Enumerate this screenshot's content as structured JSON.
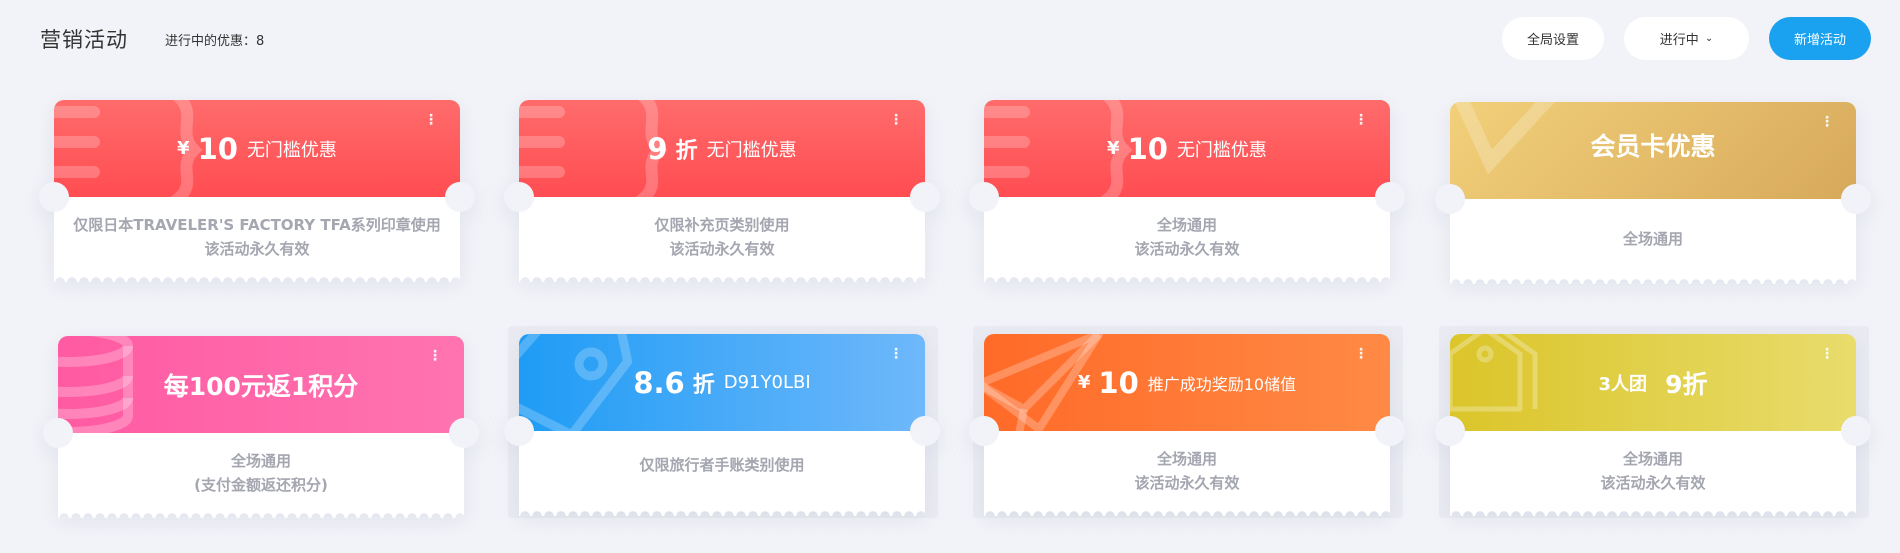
{
  "header": {
    "title": "营销活动",
    "active_label": "进行中的优惠：8",
    "global_settings": "全局设置",
    "status_filter": "进行中",
    "new_activity": "新增活动"
  },
  "colors": {
    "accent": "#1aa1f0",
    "red": "#ff4d52",
    "gold": "#d7a95b",
    "pink": "#ff5aa2",
    "blue": "#1f9cf5",
    "orange": "#ff6a28",
    "yellow": "#dbc52a"
  },
  "cards": [
    {
      "theme": "red",
      "icon": "coupon-icon",
      "currency": "¥",
      "amount": "10",
      "unit": "",
      "label": "无门槛优惠",
      "line1": "仅限日本TRAVELER'S FACTORY TFA系列印章使用",
      "line2": "该活动永久有效"
    },
    {
      "theme": "red",
      "icon": "coupon-icon",
      "currency": "",
      "amount": "9",
      "unit": "折",
      "label": "无门槛优惠",
      "line1": "仅限补充页类别使用",
      "line2": "该活动永久有效"
    },
    {
      "theme": "red",
      "icon": "coupon-icon",
      "currency": "¥",
      "amount": "10",
      "unit": "",
      "label": "无门槛优惠",
      "line1": "全场通用",
      "line2": "该活动永久有效"
    },
    {
      "theme": "gold",
      "icon": "member-card-icon",
      "headline": "会员卡优惠",
      "line1": "全场通用",
      "line2": ""
    },
    {
      "theme": "pink",
      "icon": "points-coins-icon",
      "headline": "每100元返1积分",
      "line1": "全场通用",
      "line2": "(支付金额返还积分)"
    },
    {
      "theme": "blue",
      "icon": "tag-icon",
      "currency": "",
      "amount": "8.6",
      "unit": "折",
      "label": "D91Y0LBI",
      "line1": "仅限旅行者手账类别使用",
      "line2": ""
    },
    {
      "theme": "orange",
      "icon": "paper-plane-icon",
      "currency": "¥",
      "amount": "10",
      "unit": "",
      "label": "推广成功奖励10储值",
      "line1": "全场通用",
      "line2": "该活动永久有效"
    },
    {
      "theme": "yellow",
      "icon": "group-tag-icon",
      "group_label": "3人团",
      "group_discount": "9折",
      "line1": "全场通用",
      "line2": "该活动永久有效"
    }
  ]
}
